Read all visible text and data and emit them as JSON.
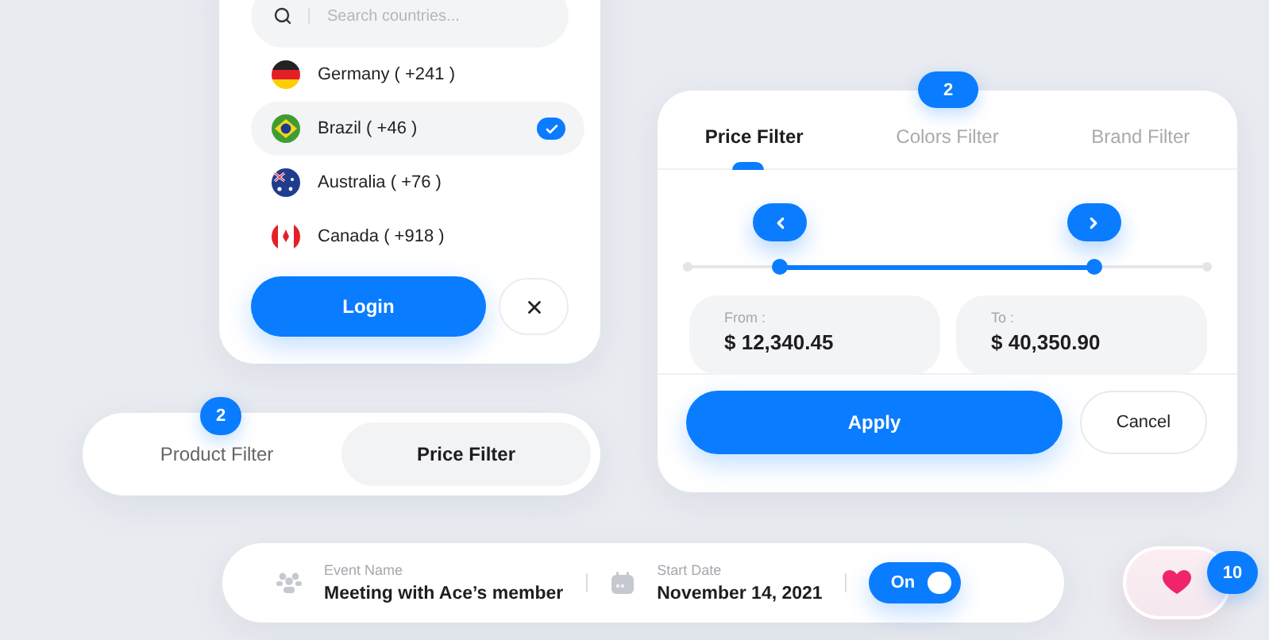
{
  "country_picker": {
    "search": {
      "placeholder": "Search countries..."
    },
    "countries": [
      {
        "name": "Germany ( +241 )",
        "kind": "de",
        "selected": false
      },
      {
        "name": "Brazil ( +46 )",
        "kind": "br",
        "selected": true
      },
      {
        "name": "Australia ( +76 )",
        "kind": "au",
        "selected": false
      },
      {
        "name": "Canada ( +918 )",
        "kind": "ca",
        "selected": false
      }
    ],
    "login_button": "Login"
  },
  "segmented_filter": {
    "badge": "2",
    "segments": [
      {
        "label": "Product Filter",
        "selected": false
      },
      {
        "label": "Price Filter",
        "selected": true
      }
    ]
  },
  "price_filter": {
    "badge": "2",
    "tabs": [
      {
        "label": "Price Filter",
        "selected": true
      },
      {
        "label": "Colors Filter",
        "selected": false
      },
      {
        "label": "Brand Filter",
        "selected": false
      }
    ],
    "thumbs": [
      {
        "level": 0.18
      },
      {
        "level": 0.78
      }
    ],
    "fields": [
      {
        "label": "From :",
        "value": "$ 12,340.45"
      },
      {
        "label": "To :",
        "value": "$ 40,350.90"
      }
    ],
    "apply_button": "Apply",
    "cancel_button": "Cancel"
  },
  "event_bar": {
    "fields": [
      {
        "kind": "people",
        "label": "Event Name",
        "value": "Meeting with Ace’s member"
      },
      {
        "kind": "calendar",
        "label": "Start Date",
        "value": "November 14, 2021"
      }
    ],
    "toggle": {
      "label": "On",
      "on": true
    }
  },
  "favorite": {
    "count": "10"
  }
}
